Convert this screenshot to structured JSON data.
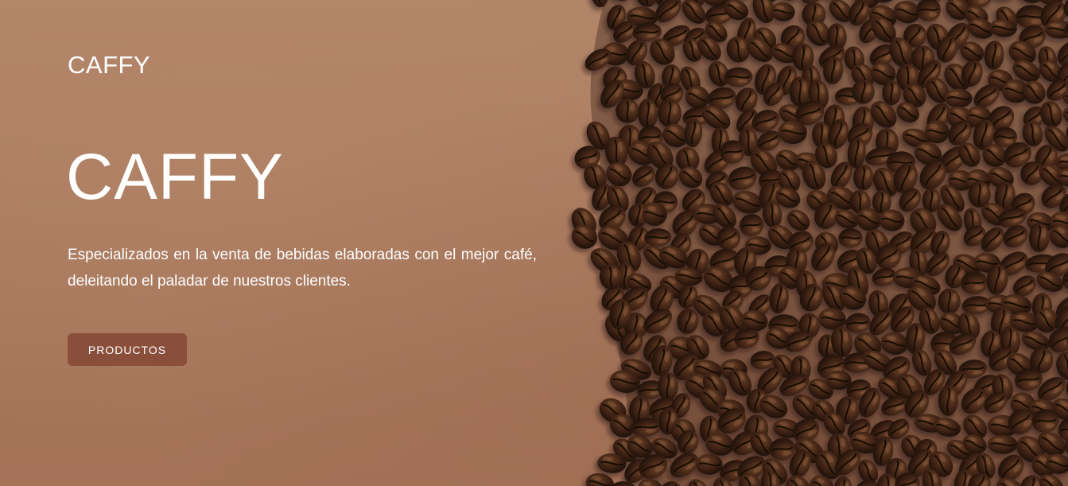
{
  "header": {
    "brand": "CAFFY"
  },
  "hero": {
    "title": "CAFFY",
    "description": "Especializados en la venta de bebidas elaboradas con el mejor café, deleitando el paladar de nuestros clientes.",
    "cta_label": "PRODUCTOS",
    "background_image": "coffee-beans-image"
  },
  "colors": {
    "background": "#a8775b",
    "button": "#8a4f3a",
    "text": "#ffffff"
  }
}
